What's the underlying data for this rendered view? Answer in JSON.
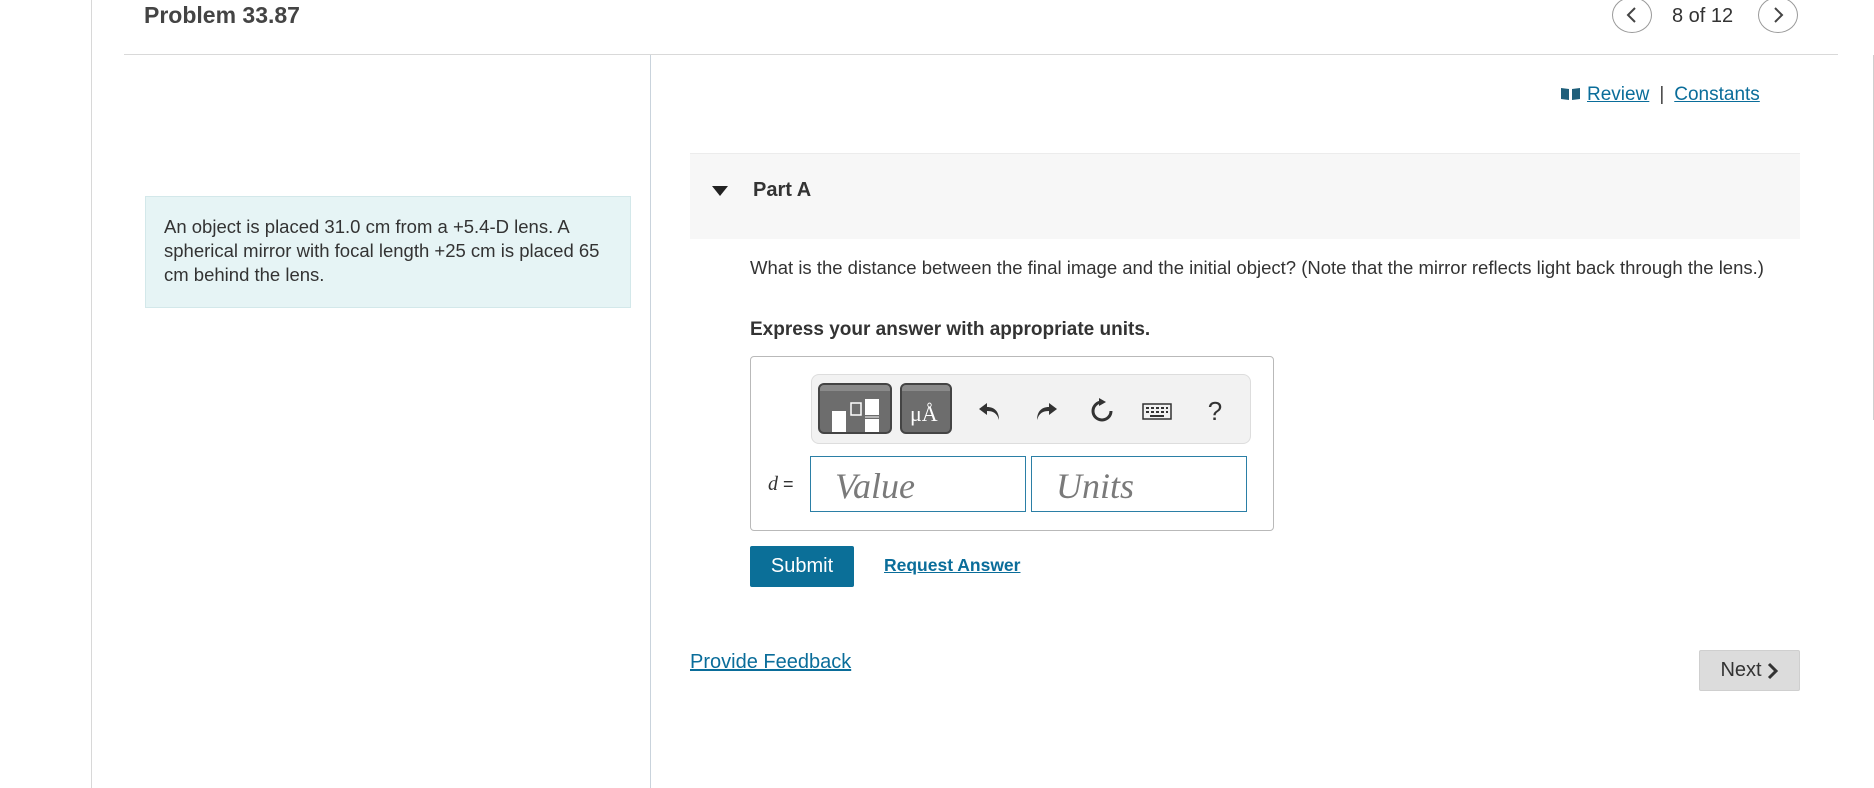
{
  "header": {
    "problem_title": "Problem 33.87",
    "pager": "8 of 12"
  },
  "problem": {
    "text": "An object is placed 31.0 cm from a +5.4-D lens. A spherical mirror with focal length +25 cm is placed 65 cm behind the lens."
  },
  "links": {
    "review": "Review",
    "separator": "|",
    "constants": "Constants"
  },
  "part": {
    "title": "Part A",
    "question": "What is the distance between the final image and the initial object? (Note that the mirror reflects light back through the lens.)",
    "instructions": "Express your answer with appropriate units."
  },
  "answer": {
    "variable": "d",
    "equals": "=",
    "value_placeholder": "Value",
    "units_placeholder": "Units",
    "toolbar": {
      "units_glyph": "μÅ",
      "help_glyph": "?"
    }
  },
  "actions": {
    "submit": "Submit",
    "request_answer": "Request Answer",
    "provide_feedback": "Provide Feedback",
    "next": "Next"
  },
  "colors": {
    "accent": "#0b6f98",
    "link": "#0a6d9a",
    "problem_bg": "#e6f4f5"
  }
}
